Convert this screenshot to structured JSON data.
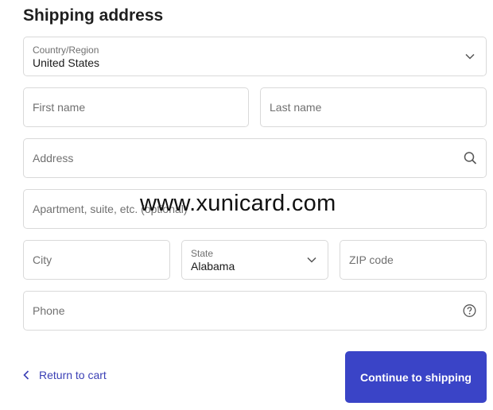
{
  "heading": "Shipping address",
  "country": {
    "label": "Country/Region",
    "value": "United States"
  },
  "first_name": {
    "placeholder": "First name"
  },
  "last_name": {
    "placeholder": "Last name"
  },
  "address": {
    "placeholder": "Address"
  },
  "apartment": {
    "placeholder": "Apartment, suite, etc. (optional)"
  },
  "city": {
    "placeholder": "City"
  },
  "state": {
    "label": "State",
    "value": "Alabama"
  },
  "zip": {
    "placeholder": "ZIP code"
  },
  "phone": {
    "placeholder": "Phone"
  },
  "return_link": "Return to cart",
  "continue_button": "Continue to shipping",
  "watermark": "www.xunicard.com",
  "colors": {
    "accent": "#3a44c7",
    "link": "#3a3fb5",
    "border": "#d9d9d9"
  }
}
